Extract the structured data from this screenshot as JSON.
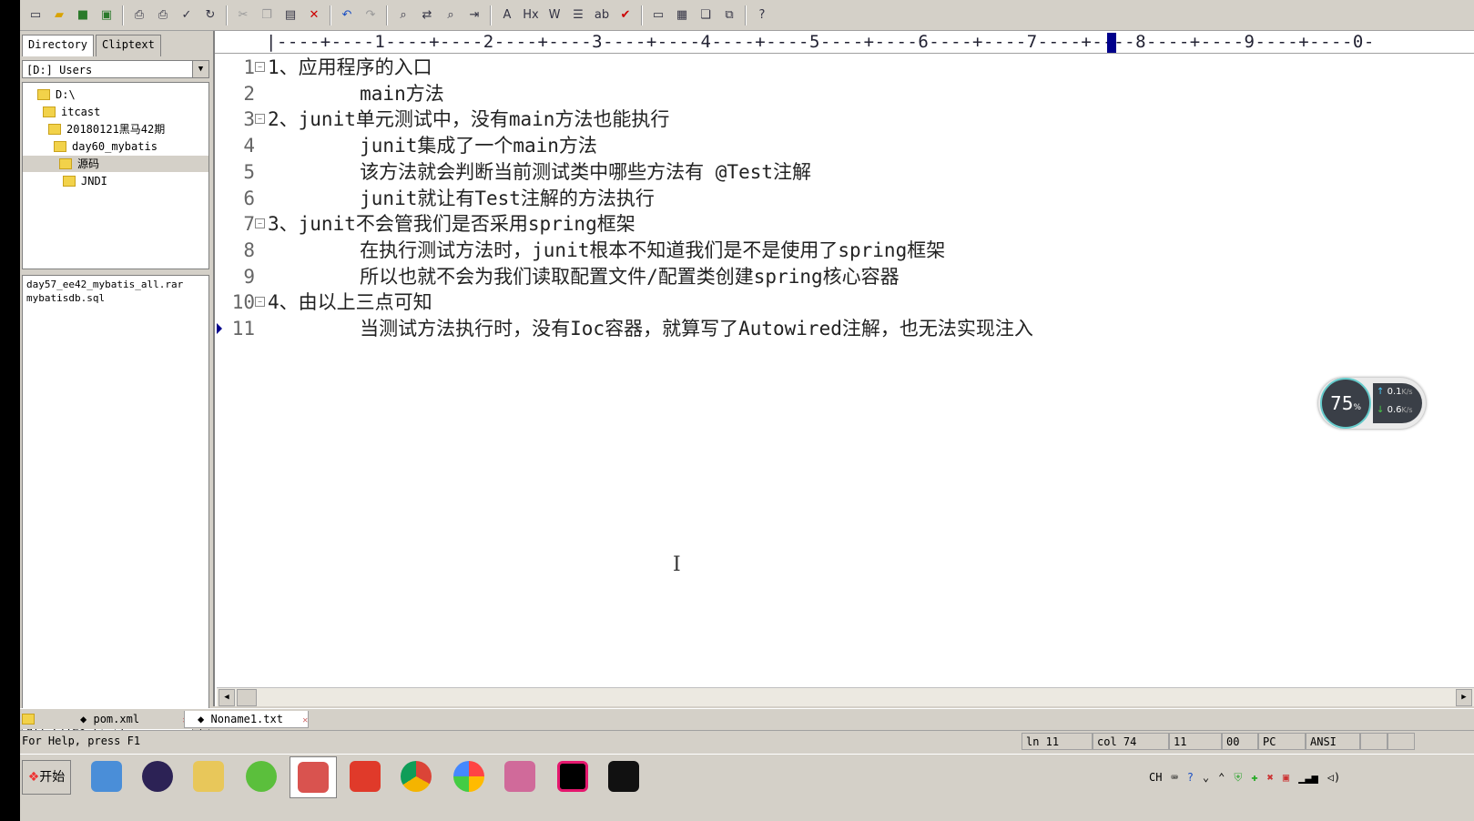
{
  "toolbar": {
    "icons": [
      "new-file-icon",
      "open-file-icon",
      "save-icon",
      "save-all-icon",
      "print-preview-icon",
      "print-icon",
      "spell-check-icon",
      "refresh-icon",
      "cut-icon",
      "copy-icon",
      "paste-icon",
      "delete-icon",
      "undo-icon",
      "redo-icon",
      "find-icon",
      "replace-icon",
      "find-in-files-icon",
      "goto-icon",
      "font-icon",
      "hex-icon",
      "word-wrap-icon",
      "list-icon",
      "abc-icon",
      "check-icon",
      "window-icon",
      "tile-icon",
      "cascade-icon",
      "restore-icon",
      "help-icon"
    ]
  },
  "left_panel": {
    "tabs": [
      "Directory",
      "Cliptext"
    ],
    "drive": "[D:] Users",
    "tree": [
      {
        "label": "D:\\",
        "level": 0
      },
      {
        "label": "itcast",
        "level": 1
      },
      {
        "label": "20180121黑马42期",
        "level": 2
      },
      {
        "label": "day60_mybatis",
        "level": 3
      },
      {
        "label": "源码",
        "level": 4,
        "selected": true
      },
      {
        "label": "JNDI",
        "level": 4
      }
    ],
    "files": [
      "day57_ee42_mybatis_all.rar",
      "mybatisdb.sql"
    ],
    "filter": "All Files (*.*)"
  },
  "editor": {
    "ruler": "|----+----1----+----2----+----3----+----4----+----5----+----6----+----7----+----8----+----9----+----0-",
    "lines": [
      {
        "num": "1",
        "fold": true,
        "text": "1、应用程序的入口"
      },
      {
        "num": "2",
        "fold": false,
        "text": "        main方法"
      },
      {
        "num": "3",
        "fold": true,
        "text": "2、junit单元测试中，没有main方法也能执行"
      },
      {
        "num": "4",
        "fold": false,
        "text": "        junit集成了一个main方法"
      },
      {
        "num": "5",
        "fold": false,
        "text": "        该方法就会判断当前测试类中哪些方法有 @Test注解"
      },
      {
        "num": "6",
        "fold": false,
        "text": "        junit就让有Test注解的方法执行"
      },
      {
        "num": "7",
        "fold": true,
        "text": "3、junit不会管我们是否采用spring框架"
      },
      {
        "num": "8",
        "fold": false,
        "text": "        在执行测试方法时，junit根本不知道我们是不是使用了spring框架"
      },
      {
        "num": "9",
        "fold": false,
        "text": "        所以也就不会为我们读取配置文件/配置类创建spring核心容器"
      },
      {
        "num": "10",
        "fold": true,
        "text": "4、由以上三点可知"
      },
      {
        "num": "11",
        "fold": false,
        "text": "        当测试方法执行时，没有Ioc容器，就算写了Autowired注解，也无法实现注入",
        "current": true
      }
    ]
  },
  "speed_widget": {
    "percent": "75",
    "percent_unit": "%",
    "up": "0.1",
    "down": "0.6",
    "unit": "K/s"
  },
  "file_tabs": [
    {
      "label": "pom.xml"
    },
    {
      "label": "Noname1.txt",
      "active": true
    }
  ],
  "status": {
    "help": "For Help, press F1",
    "ln": "ln 11",
    "col": "col 74",
    "lines": "11",
    "mode": "00",
    "eol": "PC",
    "encoding": "ANSI"
  },
  "taskbar": {
    "start": "开始",
    "apps": [
      "computer-icon",
      "eclipse-icon",
      "explorer-icon",
      "app-green-icon",
      "editor-icon",
      "app-g-icon",
      "chrome-icon",
      "photos-icon",
      "ice-icon",
      "intellij-icon",
      "cmd-icon"
    ],
    "tray_lang": "CH"
  },
  "colors": {
    "accent": "#00008b",
    "window_bg": "#d4d0c8"
  }
}
